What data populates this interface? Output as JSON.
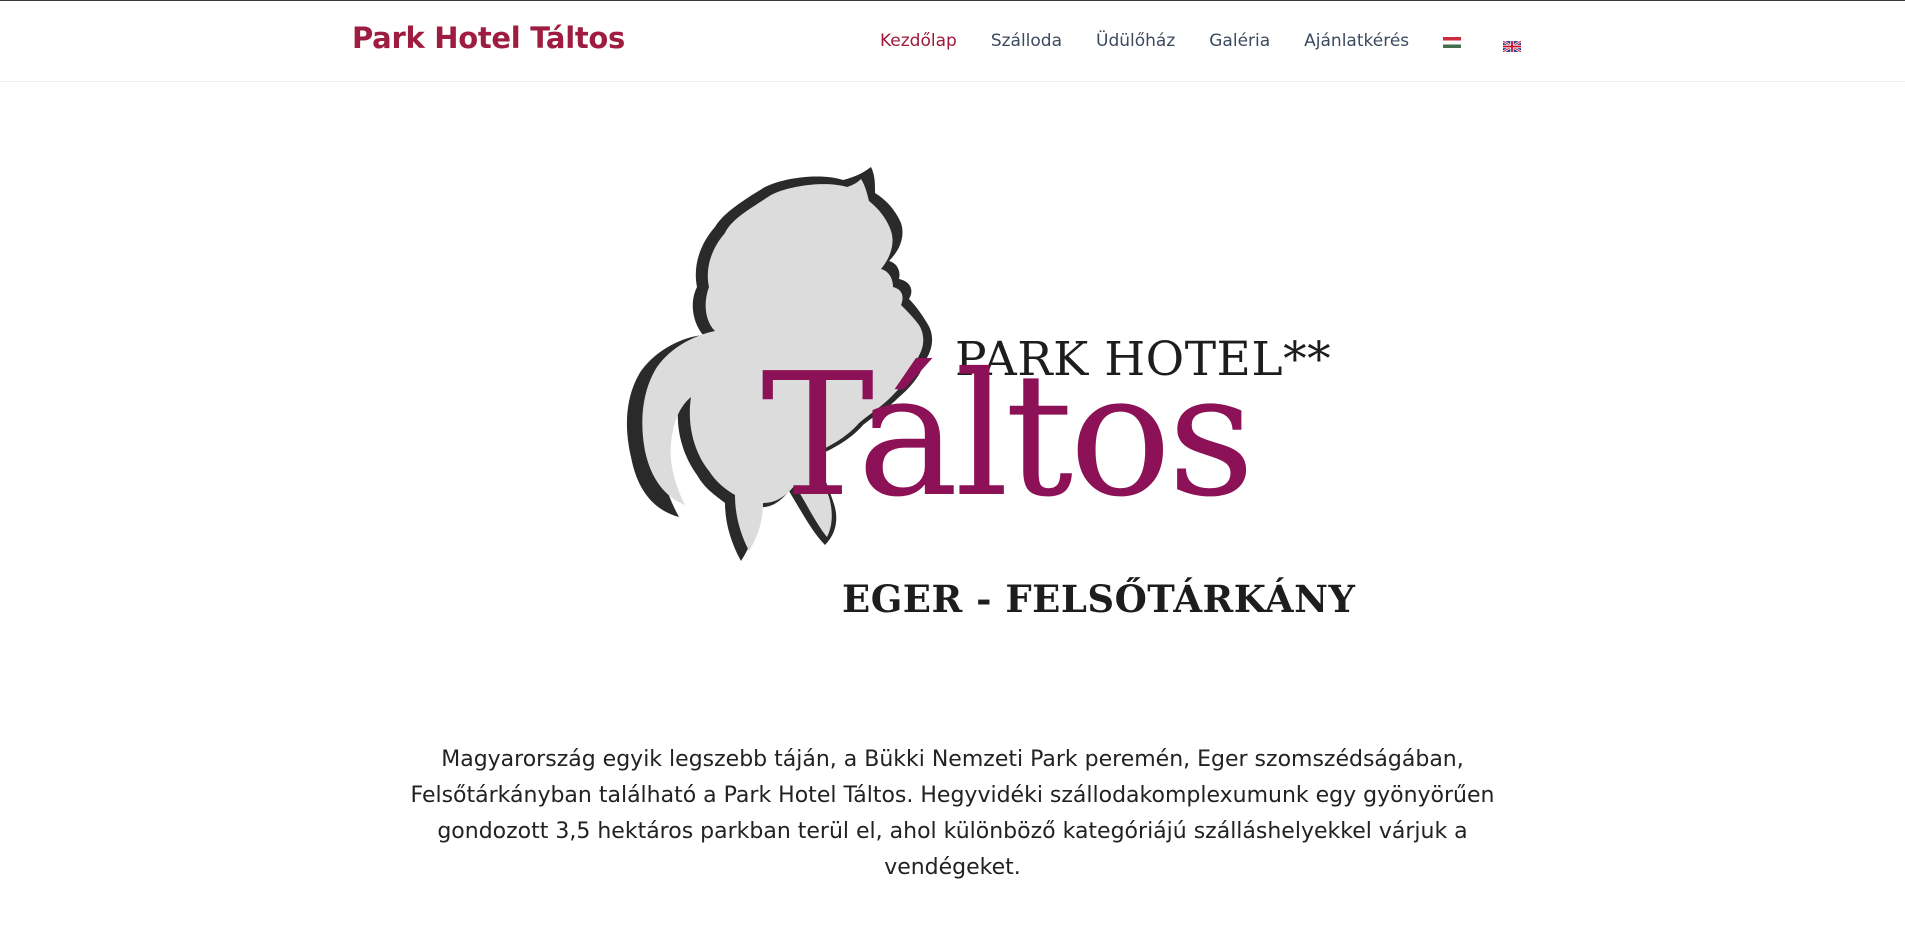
{
  "header": {
    "brand": "Park Hotel Táltos",
    "nav": [
      {
        "label": "Kezdőlap",
        "active": true
      },
      {
        "label": "Szálloda",
        "active": false
      },
      {
        "label": "Üdülőház",
        "active": false
      },
      {
        "label": "Galéria",
        "active": false
      },
      {
        "label": "Ajánlatkérés",
        "active": false
      }
    ],
    "languages": [
      {
        "code": "hu",
        "icon": "hungarian-flag-icon"
      },
      {
        "code": "en",
        "icon": "uk-flag-icon"
      }
    ]
  },
  "logo": {
    "line1": "PARK HOTEL**",
    "name": "Táltos",
    "location": "EGER - FELSŐTÁRKÁNY",
    "icon": "rearing-horse-icon"
  },
  "intro": {
    "text": "Magyarország egyik legszebb táján, a Bükki Nemzeti Park peremén, Eger szomszédságában, Felsőtárkányban található a Park Hotel Táltos. Hegyvidéki szállodakomplexumunk egy gyönyörűen gondozott 3,5 hektáros parkban terül el, ahol különböző kategóriájú szálláshelyekkel várjuk a vendégeket."
  },
  "colors": {
    "brand": "#9e1c3f",
    "logo_name": "#8c1157",
    "nav_text": "#3c4a5e",
    "horse_fill": "#dcdcdc"
  }
}
